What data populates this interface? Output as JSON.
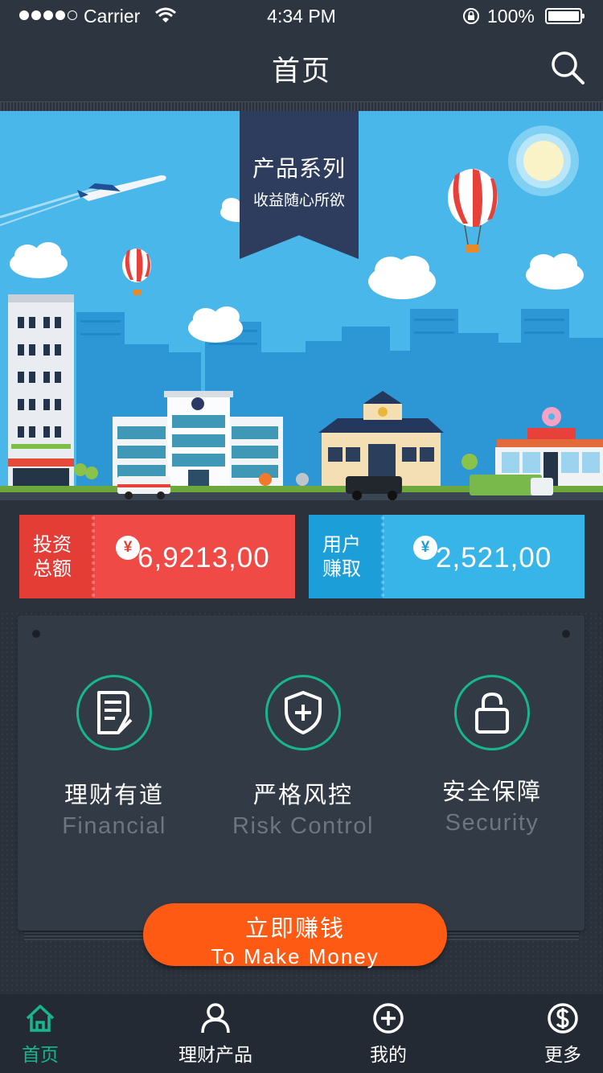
{
  "status_bar": {
    "carrier": "Carrier",
    "time": "4:34 PM",
    "battery": "100%",
    "signal_icon": "signal-dots-icon",
    "wifi_icon": "wifi-icon",
    "lock_icon": "rotation-lock-icon"
  },
  "nav": {
    "title": "首页",
    "search_icon": "search-icon"
  },
  "banner": {
    "ribbon_title": "产品系列",
    "ribbon_subtitle": "收益随心所欲"
  },
  "stats": {
    "invest": {
      "label_line1": "投资",
      "label_line2": "总额",
      "currency": "¥",
      "amount": "6,9213,00"
    },
    "earn": {
      "label_line1": "用户",
      "label_line2": "赚取",
      "currency": "¥",
      "amount": "2,521,00"
    }
  },
  "features": [
    {
      "title": "理财有道",
      "subtitle": "Financial",
      "icon": "document-icon"
    },
    {
      "title": "严格风控",
      "subtitle": "Risk Control",
      "icon": "shield-plus-icon"
    },
    {
      "title": "安全保障",
      "subtitle": "Security",
      "icon": "unlock-icon"
    }
  ],
  "cta": {
    "label_cn": "立即赚钱",
    "label_en": "To Make Money"
  },
  "tabs": [
    {
      "label": "首页",
      "icon": "home-icon",
      "active": true
    },
    {
      "label": "理财产品",
      "icon": "user-icon",
      "active": false
    },
    {
      "label": "我的",
      "icon": "plus-circle-icon",
      "active": false
    },
    {
      "label": "更多",
      "icon": "dollar-circle-icon",
      "active": false
    }
  ],
  "colors": {
    "accent_green": "#17b68f",
    "invest_red": "#ef4a45",
    "earn_blue": "#37b5e8",
    "cta_orange": "#ff5a14",
    "sky_blue": "#4ab7ea"
  }
}
